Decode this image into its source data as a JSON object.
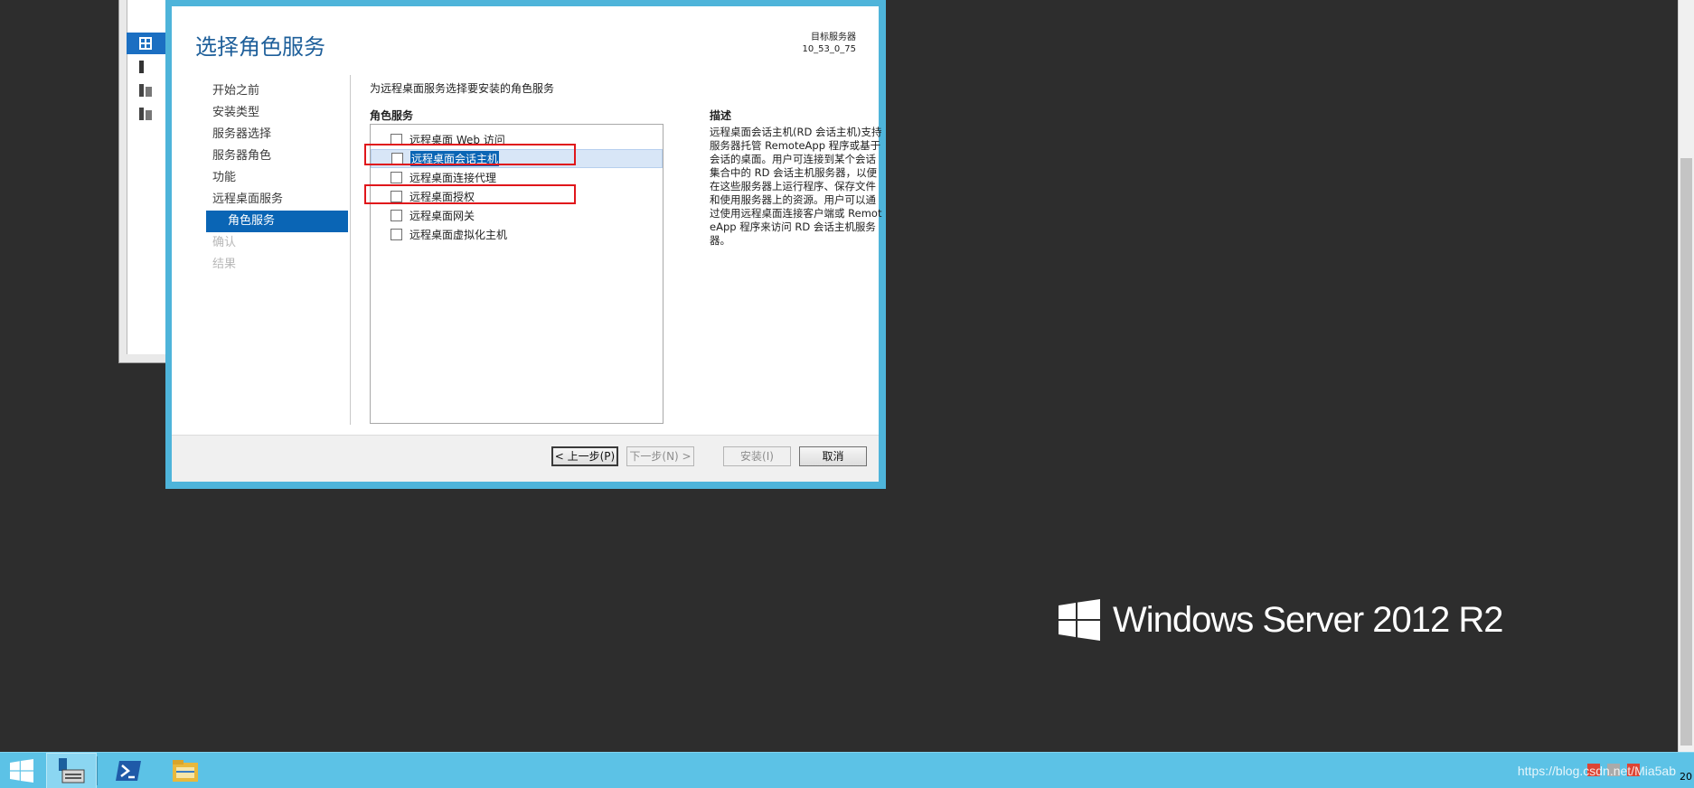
{
  "wizard": {
    "title": "选择角色服务",
    "destination_label": "目标服务器",
    "destination_value": "10_53_0_75",
    "steps": [
      {
        "label": "开始之前",
        "state": "normal"
      },
      {
        "label": "安装类型",
        "state": "normal"
      },
      {
        "label": "服务器选择",
        "state": "normal"
      },
      {
        "label": "服务器角色",
        "state": "normal"
      },
      {
        "label": "功能",
        "state": "normal"
      },
      {
        "label": "远程桌面服务",
        "state": "normal"
      },
      {
        "label": "角色服务",
        "state": "active"
      },
      {
        "label": "确认",
        "state": "disabled"
      },
      {
        "label": "结果",
        "state": "disabled"
      }
    ],
    "instruction": "为远程桌面服务选择要安装的角色服务",
    "roles_header": "角色服务",
    "roles": [
      {
        "label": "远程桌面 Web 访问",
        "checked": false,
        "selected": false
      },
      {
        "label": "远程桌面会话主机",
        "checked": false,
        "selected": true
      },
      {
        "label": "远程桌面连接代理",
        "checked": false,
        "selected": false
      },
      {
        "label": "远程桌面授权",
        "checked": false,
        "selected": false
      },
      {
        "label": "远程桌面网关",
        "checked": false,
        "selected": false
      },
      {
        "label": "远程桌面虚拟化主机",
        "checked": false,
        "selected": false
      }
    ],
    "description_header": "描述",
    "description": "远程桌面会话主机(RD 会话主机)支持服务器托管 RemoteApp 程序或基于会话的桌面。用户可连接到某个会话集合中的 RD 会话主机服务器，以便在这些服务器上运行程序、保存文件和使用服务器上的资源。用户可以通过使用远程桌面连接客户端或 RemoteApp 程序来访问 RD 会话主机服务器。",
    "buttons": {
      "previous": "< 上一步(P)",
      "next": "下一步(N) >",
      "install": "安装(I)",
      "cancel": "取消"
    }
  },
  "branding": {
    "text": "Windows Server 2012 R2"
  },
  "taskbar": {
    "watermark": "https://blog.csdn.net/Mia5ab",
    "clock": "20"
  },
  "colors": {
    "wizard_border": "#4eb4da",
    "accent": "#0a65b5",
    "annotation": "#e0161b",
    "desktop": "#2d2d2d",
    "taskbar": "#5cc2e6"
  }
}
